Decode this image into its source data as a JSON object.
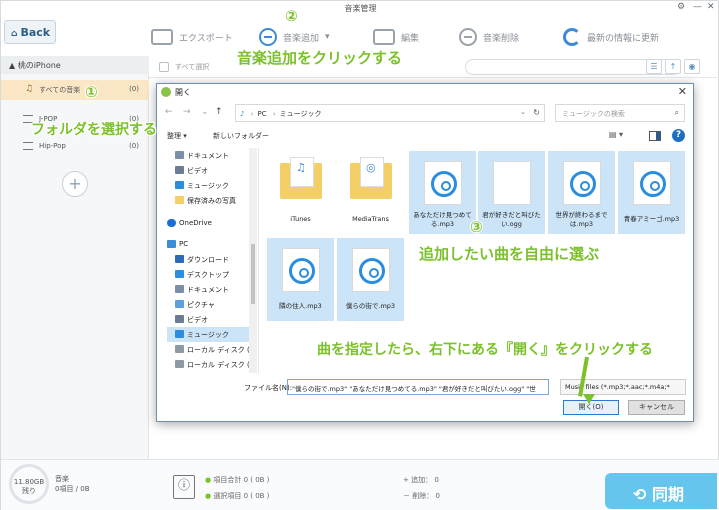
{
  "window": {
    "title": "音楽管理",
    "back_label": "Back",
    "back_icon": "home-icon"
  },
  "toolbar": {
    "export_label": "エクスポート",
    "add_music_label": "音楽追加",
    "edit_label": "編集",
    "delete_label": "音楽削除",
    "refresh_label": "最新の情報に更新"
  },
  "sidebar": {
    "device_name": "桃のiPhone",
    "all_music_label": "すべての音楽",
    "all_music_count": "(0)",
    "playlists": [
      {
        "label": "J-POP",
        "count": "(0)"
      },
      {
        "label": "Hip-Pop",
        "count": "(0)"
      }
    ],
    "add_label": "+"
  },
  "list_header": {
    "select_all_label": "すべて選択"
  },
  "bottom": {
    "storage_free": "11.80GB",
    "storage_unit": "残り",
    "category": "音楽",
    "category_stats": "0項目 / 0B",
    "total_items": "項目合計 0 ( 0B )",
    "selected_items": "選択項目 0 ( 0B )",
    "add_count": "+ 追加： 0",
    "delete_count": "－ 削除： 0",
    "sync_label": "同期"
  },
  "dialog": {
    "title": "開く",
    "path_root": "PC",
    "path_current": "ミュージック",
    "search_placeholder": "ミュージックの検索",
    "organize_label": "整理 ▾",
    "new_folder_label": "新しいフォルダー",
    "nav_items": [
      "ドキュメント",
      "ビデオ",
      "ミュージック",
      "保存済みの写真",
      "OneDrive",
      "PC",
      "ダウンロード",
      "デスクトップ",
      "ドキュメント",
      "ピクチャ",
      "ビデオ",
      "ミュージック",
      "ローカル ディスク (C",
      "ローカル ディスク (E"
    ],
    "files": [
      {
        "name": "iTunes",
        "kind": "folder",
        "selected": false
      },
      {
        "name": "MediaTrans",
        "kind": "folder",
        "selected": false
      },
      {
        "name": "あなただけ見つめてる.mp3",
        "kind": "music",
        "selected": true
      },
      {
        "name": "君が好きだと叫びたい.ogg",
        "kind": "doc",
        "selected": true
      },
      {
        "name": "世界が終わるまでは.mp3",
        "kind": "music",
        "selected": true
      },
      {
        "name": "青春アミーゴ.mp3",
        "kind": "music",
        "selected": true
      },
      {
        "name": "隣の住人.mp3",
        "kind": "music",
        "selected": true
      },
      {
        "name": "僕らの街で.mp3",
        "kind": "music",
        "selected": true
      }
    ],
    "filename_label": "ファイル名(N):",
    "filename_value": "\"僕らの街で.mp3\" \"あなただけ見つめてる.mp3\" \"君が好きだと叫びたい.ogg\" \"世",
    "filetype_value": "Music files (*.mp3;*.aac;*.m4a;*",
    "open_label": "開く(O)",
    "cancel_label": "キャンセル"
  },
  "annotations": {
    "step1_num": "①",
    "step1_text": "フォルダを選択する",
    "step2_num": "②",
    "step2_text": "音楽追加をクリックする",
    "step3_num": "③",
    "step3_text": "追加したい曲を自由に選ぶ",
    "step4_text": "曲を指定したら、右下にある『開く』をクリックする",
    "accent_color": "#7cc12b"
  }
}
